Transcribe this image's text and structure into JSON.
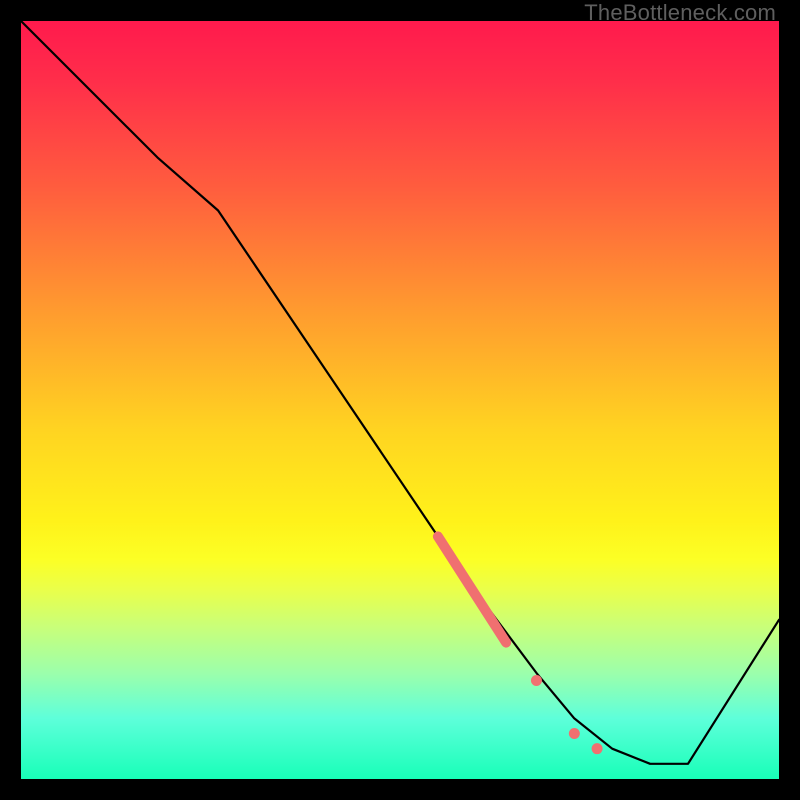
{
  "watermark": "TheBottleneck.com",
  "chart_data": {
    "type": "line",
    "title": "",
    "xlabel": "",
    "ylabel": "",
    "xlim": [
      0,
      100
    ],
    "ylim": [
      0,
      100
    ],
    "series": [
      {
        "name": "curve",
        "x": [
          0,
          18,
          26,
          55,
          62,
          68,
          73,
          78,
          83,
          88,
          100
        ],
        "values": [
          100,
          82,
          75,
          32,
          22,
          14,
          8,
          4,
          2,
          2,
          21
        ]
      }
    ],
    "highlights": [
      {
        "type": "segment",
        "x_start": 55,
        "y_start": 32,
        "x_end": 64,
        "y_end": 18
      },
      {
        "type": "dot",
        "x": 68,
        "y": 13
      },
      {
        "type": "dot",
        "x": 73,
        "y": 6
      },
      {
        "type": "dot",
        "x": 76,
        "y": 4
      }
    ]
  }
}
